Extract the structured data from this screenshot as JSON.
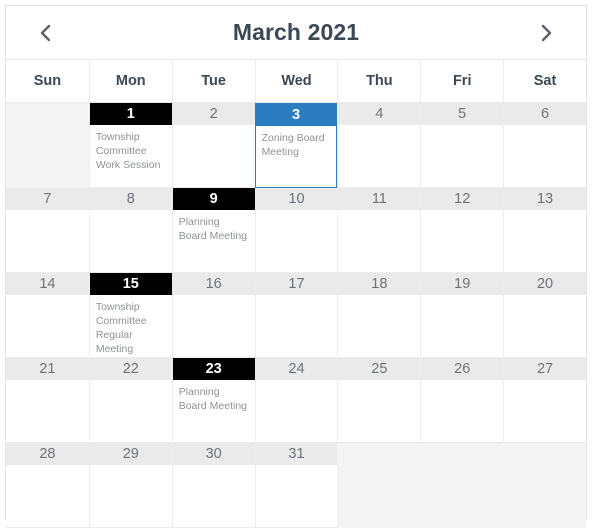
{
  "header": {
    "title": "March 2021",
    "prev_label": "‹",
    "next_label": "›",
    "prev_icon": "chevron-left-icon",
    "next_icon": "chevron-right-icon"
  },
  "weekdays": [
    "Sun",
    "Mon",
    "Tue",
    "Wed",
    "Thu",
    "Fri",
    "Sat"
  ],
  "colors": {
    "event_day_bg": "#000000",
    "selected_day_bg": "#2b7cc0",
    "normal_day_bg": "#eaeaea",
    "empty_cell_bg": "#f4f4f4",
    "title_text": "#3c4854",
    "event_text": "#8e9196",
    "grid_line": "#ececec"
  },
  "weeks": [
    [
      {
        "day": "",
        "state": "empty",
        "events": []
      },
      {
        "day": "1",
        "state": "event",
        "events": [
          "Township Committee Work Session"
        ]
      },
      {
        "day": "2",
        "state": "normal",
        "events": []
      },
      {
        "day": "3",
        "state": "selected",
        "events": [
          "Zoning Board Meeting"
        ]
      },
      {
        "day": "4",
        "state": "normal",
        "events": []
      },
      {
        "day": "5",
        "state": "normal",
        "events": []
      },
      {
        "day": "6",
        "state": "normal",
        "events": []
      }
    ],
    [
      {
        "day": "7",
        "state": "normal",
        "events": []
      },
      {
        "day": "8",
        "state": "normal",
        "events": []
      },
      {
        "day": "9",
        "state": "event",
        "events": [
          "Planning Board Meeting"
        ]
      },
      {
        "day": "10",
        "state": "normal",
        "events": []
      },
      {
        "day": "11",
        "state": "normal",
        "events": []
      },
      {
        "day": "12",
        "state": "normal",
        "events": []
      },
      {
        "day": "13",
        "state": "normal",
        "events": []
      }
    ],
    [
      {
        "day": "14",
        "state": "normal",
        "events": []
      },
      {
        "day": "15",
        "state": "event",
        "events": [
          "Township Committee Regular Meeting"
        ]
      },
      {
        "day": "16",
        "state": "normal",
        "events": []
      },
      {
        "day": "17",
        "state": "normal",
        "events": []
      },
      {
        "day": "18",
        "state": "normal",
        "events": []
      },
      {
        "day": "19",
        "state": "normal",
        "events": []
      },
      {
        "day": "20",
        "state": "normal",
        "events": []
      }
    ],
    [
      {
        "day": "21",
        "state": "normal",
        "events": []
      },
      {
        "day": "22",
        "state": "normal",
        "events": []
      },
      {
        "day": "23",
        "state": "event",
        "events": [
          "Planning Board Meeting"
        ]
      },
      {
        "day": "24",
        "state": "normal",
        "events": []
      },
      {
        "day": "25",
        "state": "normal",
        "events": []
      },
      {
        "day": "26",
        "state": "normal",
        "events": []
      },
      {
        "day": "27",
        "state": "normal",
        "events": []
      }
    ],
    [
      {
        "day": "28",
        "state": "normal",
        "events": []
      },
      {
        "day": "29",
        "state": "normal",
        "events": []
      },
      {
        "day": "30",
        "state": "normal",
        "events": []
      },
      {
        "day": "31",
        "state": "normal",
        "events": []
      },
      {
        "day": "",
        "state": "empty",
        "events": []
      },
      {
        "day": "",
        "state": "empty",
        "events": []
      },
      {
        "day": "",
        "state": "empty",
        "events": []
      }
    ]
  ]
}
